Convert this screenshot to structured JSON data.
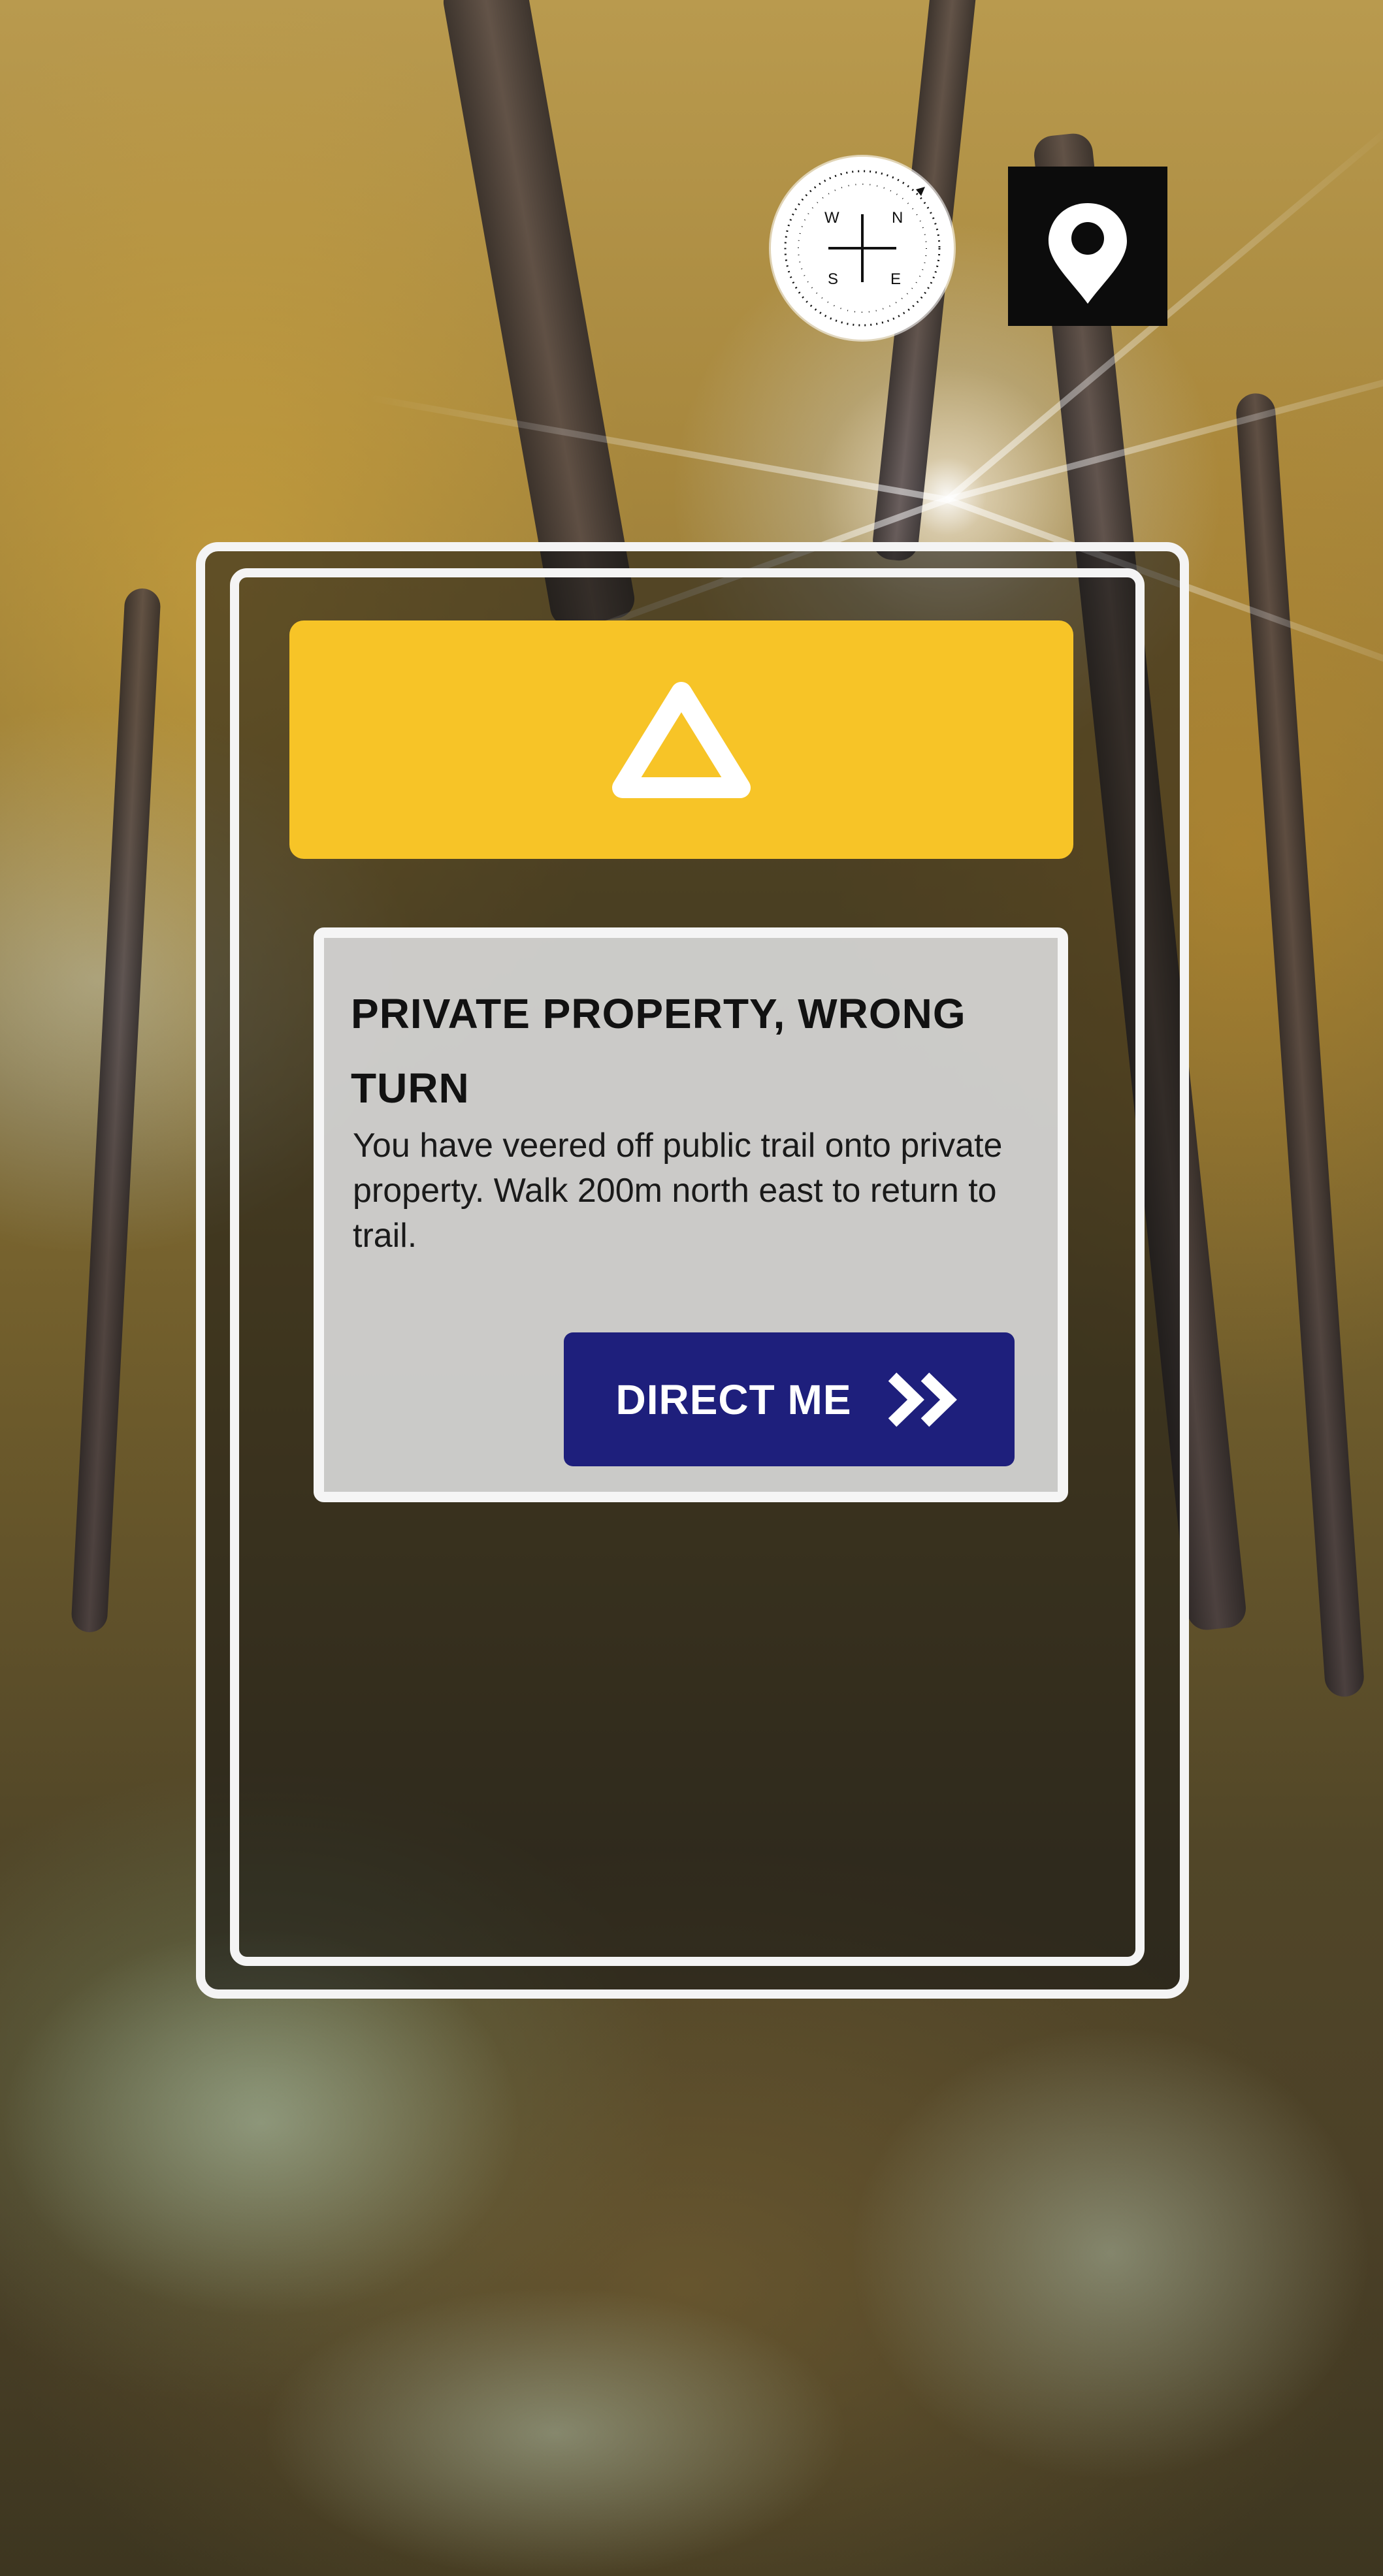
{
  "header": {
    "compass_icon": "compass-icon",
    "compass_directions": [
      "N",
      "E",
      "S",
      "W"
    ],
    "location_icon": "map-pin-icon"
  },
  "alert": {
    "banner_color": "#f7c427",
    "icon": "warning-triangle-icon",
    "title": "PRIVATE PROPERTY, WRONG TURN",
    "body": "You have veered off public trail onto private property. Walk 200m north east to return to trail.",
    "action_label": "DIRECT ME",
    "action_icon": "double-chevron-right-icon",
    "action_color": "#1e1f7c"
  }
}
